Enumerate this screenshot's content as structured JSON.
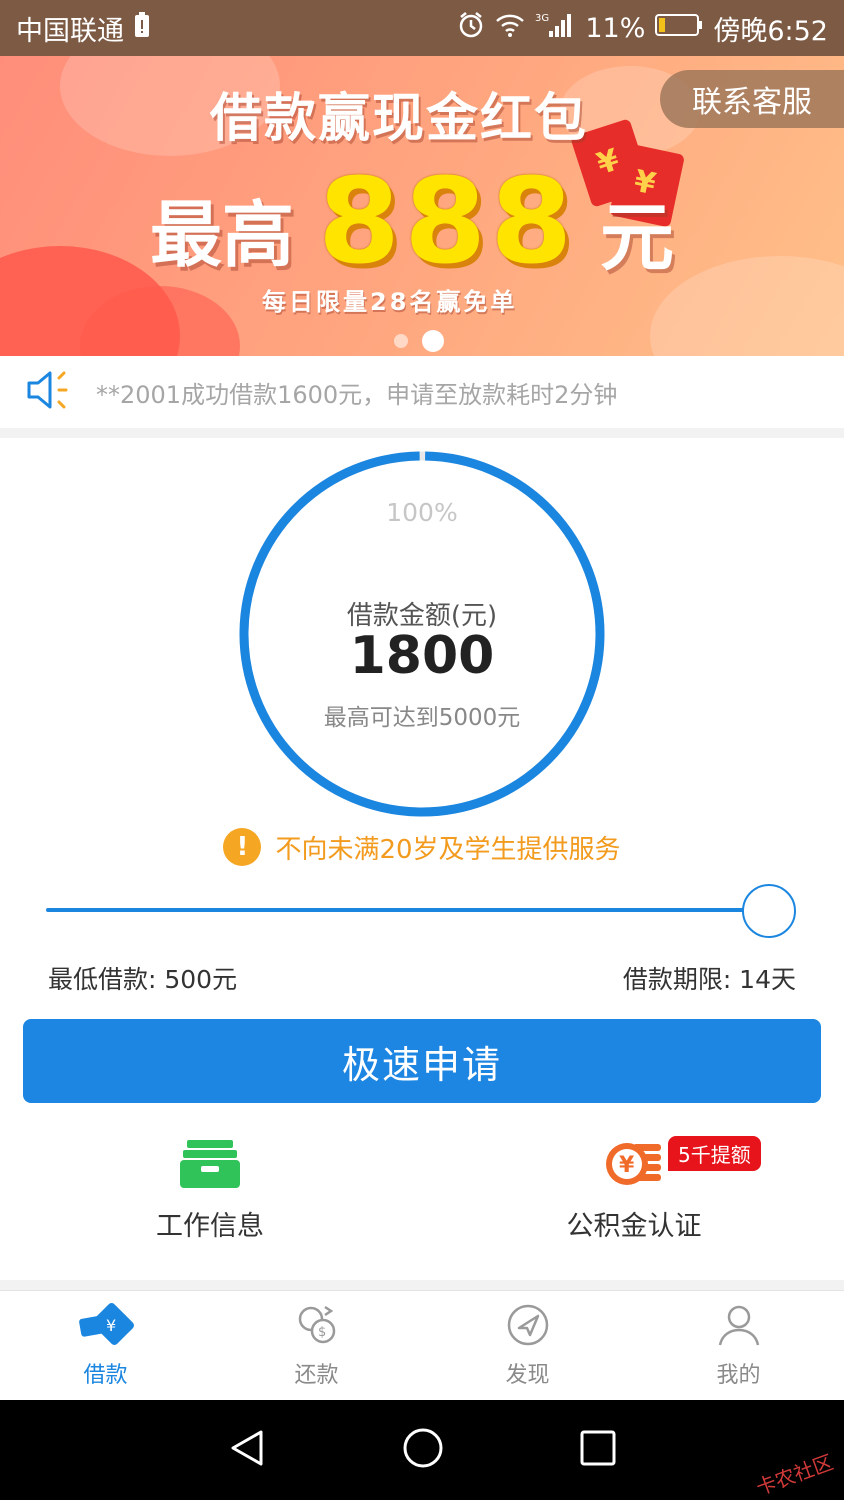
{
  "status_bar": {
    "carrier": "中国联通",
    "battery": "11%",
    "time": "傍晚6:52",
    "signal_label": "3G"
  },
  "banner": {
    "title": "借款赢现金红包",
    "max_prefix": "最高",
    "amount": "888",
    "suffix": "元",
    "subtitle": "每日限量28名赢免单",
    "service_button": "联系客服",
    "page_count": 2,
    "active_page": 2
  },
  "notice": {
    "text": "**2001成功借款1600元，申请至放款耗时2分钟"
  },
  "loan": {
    "percent": "100%",
    "percent_value": 1.0,
    "amount_label": "借款金额(元)",
    "amount": "1800",
    "max_text": "最高可达到5000元",
    "warning": "不向未满20岁及学生提供服务",
    "slider_fraction": 1.0,
    "min_label": "最低借款: 500元",
    "term_label": "借款期限: 14天",
    "apply_button": "极速申请"
  },
  "certs": [
    {
      "label": "工作信息",
      "icon": "briefcase-icon"
    },
    {
      "label": "公积金认证",
      "icon": "coin-stack-icon",
      "badge": "5千提额"
    }
  ],
  "tabs": [
    {
      "label": "借款",
      "icon": "loan-card-icon",
      "active": true
    },
    {
      "label": "还款",
      "icon": "repay-icon",
      "active": false
    },
    {
      "label": "发现",
      "icon": "compass-icon",
      "active": false
    },
    {
      "label": "我的",
      "icon": "user-icon",
      "active": false
    }
  ],
  "watermark": "卡农社区",
  "colors": {
    "primary": "#1d86e3",
    "warning": "#f29b1e",
    "badge": "#e8141b",
    "briefcase": "#2fc35a",
    "coin": "#f06a2a"
  }
}
